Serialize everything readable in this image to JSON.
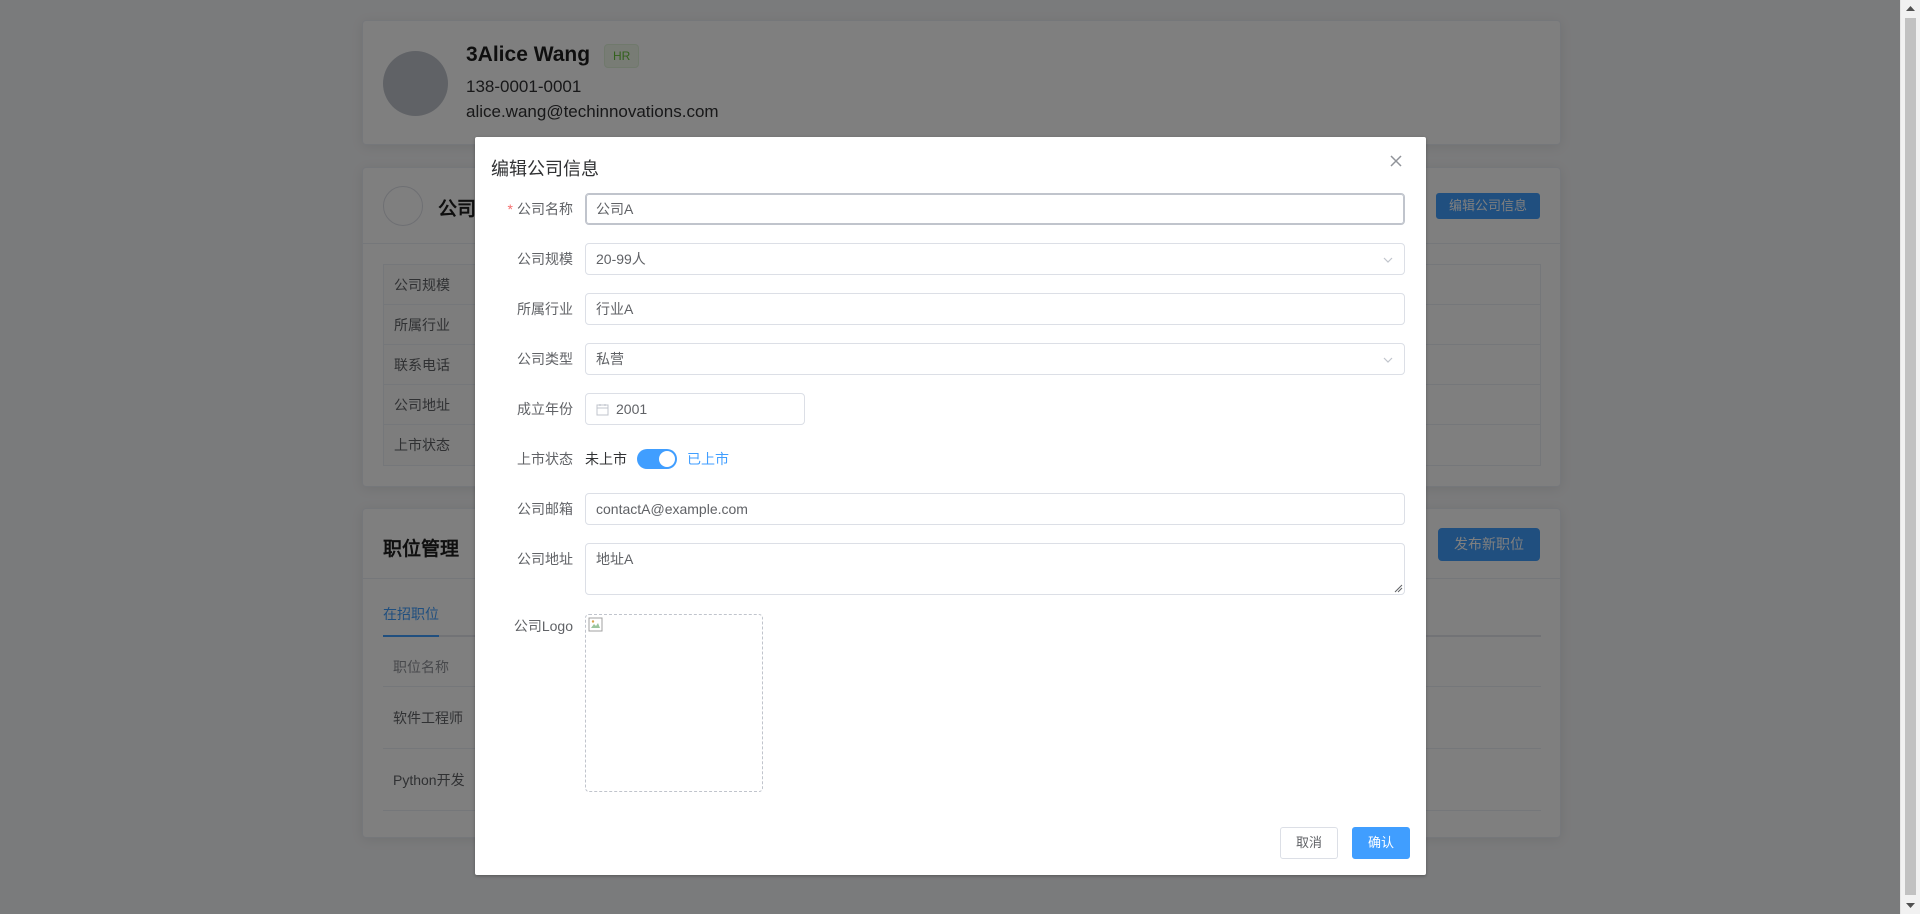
{
  "profile": {
    "name": "3Alice Wang",
    "tag": "HR",
    "phone": "138-0001-0001",
    "email": "alice.wang@techinnovations.com"
  },
  "company_card": {
    "title": "公司A",
    "edit_button": "编辑公司信息",
    "labels": [
      "公司规模",
      "所属行业",
      "联系电话",
      "公司地址",
      "上市状态"
    ]
  },
  "jobs_card": {
    "title": "职位管理",
    "publish_button": "发布新职位",
    "active_tab": "在招职位",
    "column_header": "职位名称",
    "rows": [
      "软件工程师",
      "Python开发"
    ]
  },
  "dialog": {
    "title": "编辑公司信息",
    "fields": {
      "name": {
        "label": "公司名称",
        "value": "公司A"
      },
      "size": {
        "label": "公司规模",
        "value": "20-99人"
      },
      "industry": {
        "label": "所属行业",
        "value": "行业A"
      },
      "type": {
        "label": "公司类型",
        "value": "私营"
      },
      "founded": {
        "label": "成立年份",
        "value": "2001"
      },
      "listing": {
        "label": "上市状态",
        "off_label": "未上市",
        "on_label": "已上市",
        "on": true
      },
      "email": {
        "label": "公司邮箱",
        "value": "contactA@example.com"
      },
      "address": {
        "label": "公司地址",
        "value": "地址A"
      },
      "logo": {
        "label": "公司Logo"
      }
    },
    "cancel_button": "取消",
    "confirm_button": "确认"
  },
  "colors": {
    "primary": "#409eff",
    "required": "#f56c6c",
    "tag_green": "#67c23a"
  }
}
